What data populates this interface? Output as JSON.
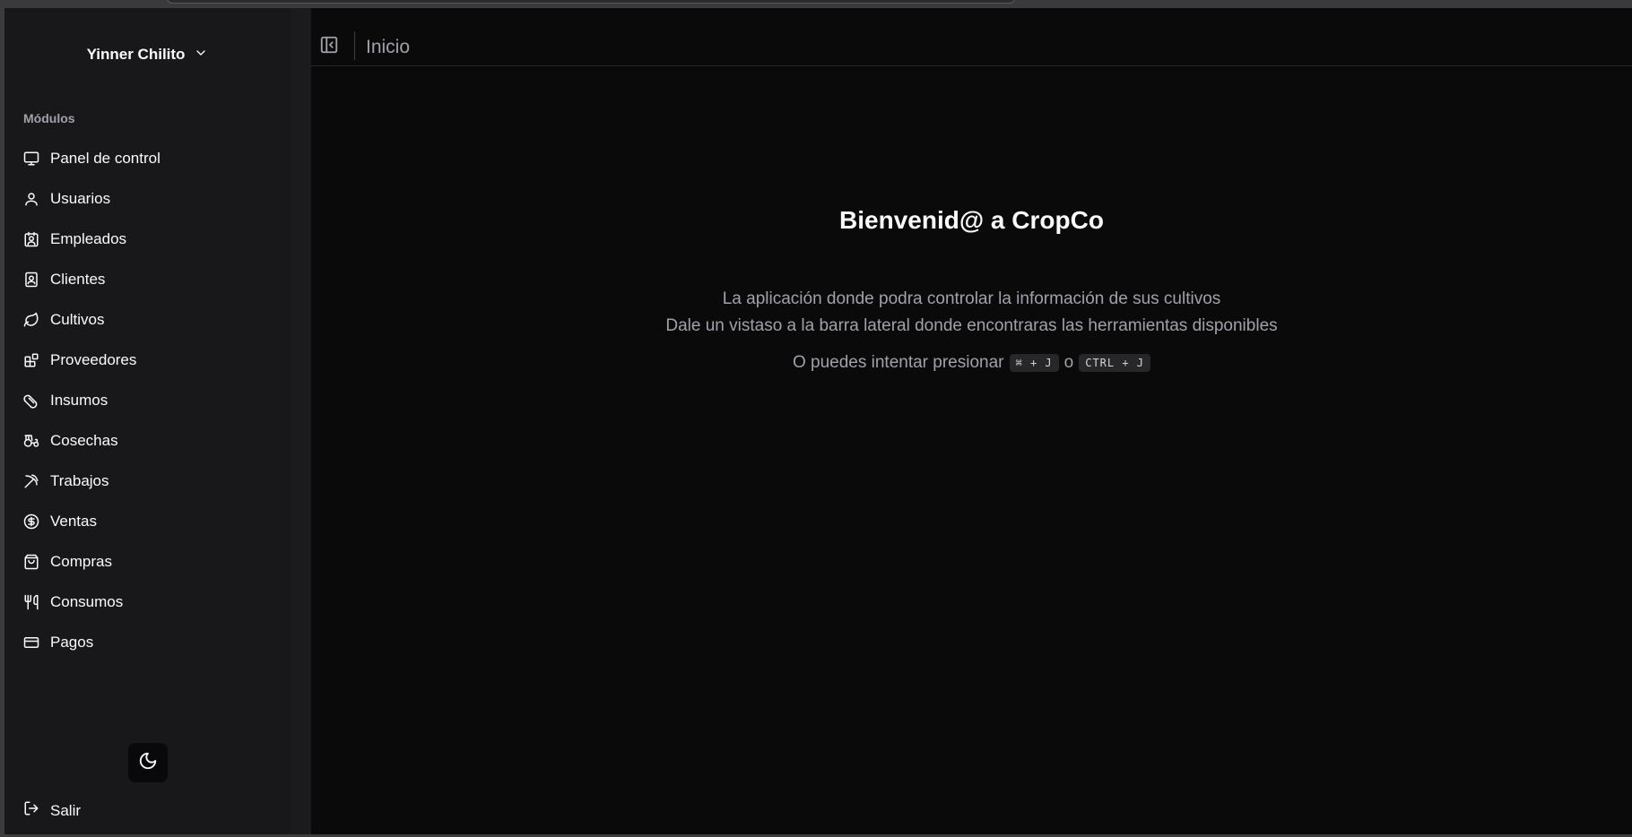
{
  "user": {
    "name": "Yinner Chilito"
  },
  "sidebar": {
    "section_label": "Módulos",
    "items": [
      {
        "label": "Panel de control",
        "icon": "monitor-icon"
      },
      {
        "label": "Usuarios",
        "icon": "user-icon"
      },
      {
        "label": "Empleados",
        "icon": "contact-icon"
      },
      {
        "label": "Clientes",
        "icon": "contact-square-icon"
      },
      {
        "label": "Cultivos",
        "icon": "leaf-icon"
      },
      {
        "label": "Proveedores",
        "icon": "blocks-icon"
      },
      {
        "label": "Insumos",
        "icon": "pill-icon"
      },
      {
        "label": "Cosechas",
        "icon": "tractor-icon"
      },
      {
        "label": "Trabajos",
        "icon": "pickaxe-icon"
      },
      {
        "label": "Ventas",
        "icon": "dollar-circle-icon"
      },
      {
        "label": "Compras",
        "icon": "shopping-bag-icon"
      },
      {
        "label": "Consumos",
        "icon": "utensils-icon"
      },
      {
        "label": "Pagos",
        "icon": "credit-card-icon"
      }
    ],
    "logout_label": "Salir"
  },
  "header": {
    "breadcrumb": "Inicio"
  },
  "main": {
    "title": "Bienvenid@ a CropCo",
    "line1": "La aplicación donde podra controlar la información de sus cultivos",
    "line2": "Dale un vistaso a la barra lateral donde encontraras las herramientas disponibles",
    "line3_prefix": "O puedes intentar presionar",
    "shortcut_mac": "⌘ + J",
    "or_text": "o",
    "shortcut_win": "CTRL + J"
  },
  "colors": {
    "sidebar_bg": "#18181b",
    "content_bg": "#0b0a0a",
    "text": "#fafafa",
    "muted_text": "#a1a1aa"
  }
}
